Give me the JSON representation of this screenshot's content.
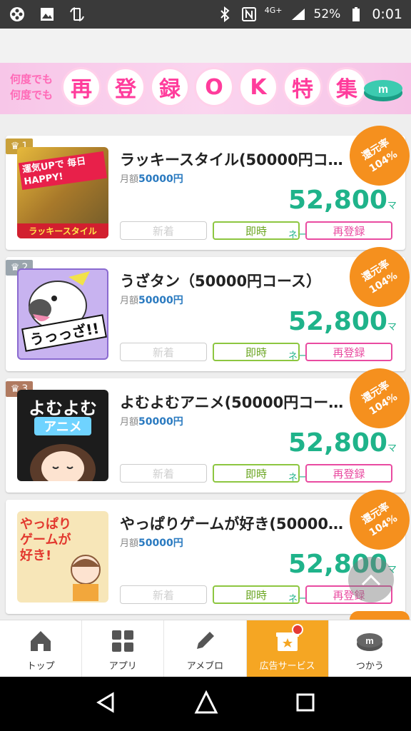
{
  "status": {
    "network": "4G+",
    "battery": "52%",
    "time": "0:01"
  },
  "banner": {
    "small_line1": "何度でも",
    "small_line2": "何度でも",
    "chars": [
      "再",
      "登",
      "録",
      "O",
      "K",
      "特",
      "集"
    ]
  },
  "offers": [
    {
      "rank": "1",
      "title": "ラッキースタイル(50000円コ…",
      "price_label": "月額",
      "price": "50000円",
      "money": "52,800",
      "unit": "マネー",
      "rate_line1": "還元率",
      "rate_line2": "104%",
      "tags": [
        "新着",
        "即時",
        "再登録"
      ],
      "thumb_text": "運気UPで 毎日HAPPY!",
      "thumb_sub": "ラッキースタイル"
    },
    {
      "rank": "2",
      "title": "うざタン（50000円コース）",
      "price_label": "月額",
      "price": "50000円",
      "money": "52,800",
      "unit": "マネー",
      "rate_line1": "還元率",
      "rate_line2": "104%",
      "tags": [
        "新着",
        "即時",
        "再登録"
      ],
      "thumb_text": "うっっざ!!"
    },
    {
      "rank": "3",
      "title": "よむよむアニメ(50000円コー…",
      "price_label": "月額",
      "price": "50000円",
      "money": "52,800",
      "unit": "マネー",
      "rate_line1": "還元率",
      "rate_line2": "104%",
      "tags": [
        "新着",
        "即時",
        "再登録"
      ],
      "thumb_text": "よむよむ",
      "thumb_sub": "アニメ"
    },
    {
      "rank": "",
      "title": "やっぱりゲームが好き(50000…",
      "price_label": "月額",
      "price": "50000円",
      "money": "52,800",
      "unit": "マネー",
      "rate_line1": "還元率",
      "rate_line2": "104%",
      "tags": [
        "新着",
        "即時",
        "再登録"
      ],
      "thumb_text": "やっぱり ゲームが 好き!"
    }
  ],
  "tabs": [
    {
      "label": "トップ",
      "icon": "home-icon"
    },
    {
      "label": "アプリ",
      "icon": "grid-icon"
    },
    {
      "label": "アメブロ",
      "icon": "pencil-icon"
    },
    {
      "label": "広告サービス",
      "icon": "gift-box-icon",
      "active": true
    },
    {
      "label": "つかう",
      "icon": "coin-icon"
    }
  ],
  "colors": {
    "accent": "#f5a623",
    "money": "#1fb38a",
    "rank1": "#c9a03a",
    "rank2": "#9aa5ad",
    "rank3": "#b07a60"
  }
}
